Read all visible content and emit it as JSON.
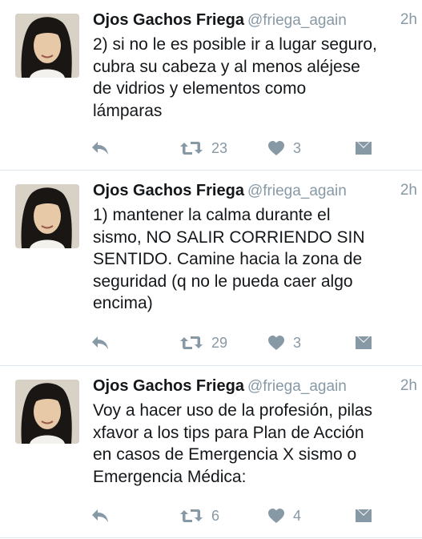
{
  "tweets": [
    {
      "name": "Ojos Gachos Friega",
      "handle": "@friega_again",
      "time": "2h",
      "text": "2) si no le es posible ir a lugar seguro,\ncubra su cabeza y al menos aléjese\nde vidrios y elementos como\nlámparas",
      "retweets": "23",
      "likes": "3"
    },
    {
      "name": "Ojos Gachos Friega",
      "handle": "@friega_again",
      "time": "2h",
      "text": "1) mantener la calma durante el\nsismo, NO SALIR CORRIENDO SIN\nSENTIDO. Camine hacia la zona de\nseguridad (q no le pueda caer algo\nencima)",
      "retweets": "29",
      "likes": "3"
    },
    {
      "name": "Ojos Gachos Friega",
      "handle": "@friega_again",
      "time": "2h",
      "text": "Voy a hacer uso de la profesión, pilas\nxfavor a los tips para Plan de Acción\nen casos de Emergencia X sismo o\nEmergencia Médica:",
      "retweets": "6",
      "likes": "4"
    }
  ],
  "icons": {
    "reply": "reply-icon",
    "retweet": "retweet-icon",
    "like": "heart-icon",
    "dm": "direct-message-icon"
  },
  "colors": {
    "text": "#14171a",
    "secondary": "#8899a6",
    "divider": "#e1e8ed"
  }
}
